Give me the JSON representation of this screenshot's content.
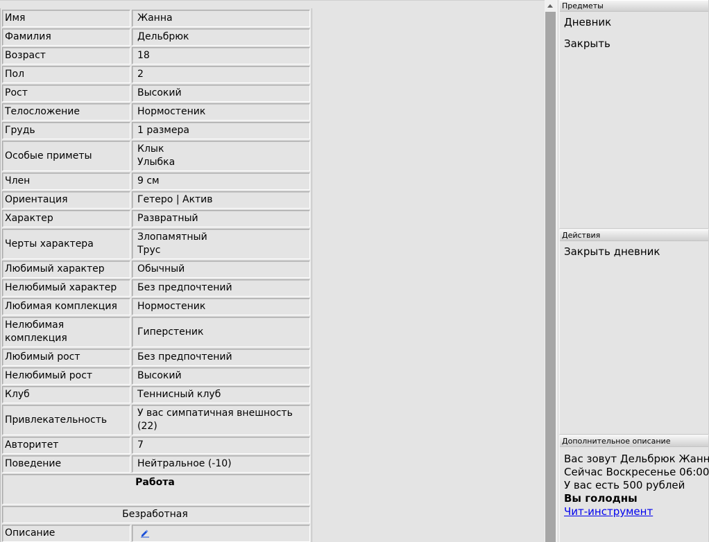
{
  "stats": [
    {
      "label": "Имя",
      "value": [
        "Жанна"
      ]
    },
    {
      "label": "Фамилия",
      "value": [
        "Дельбрюк"
      ]
    },
    {
      "label": "Возраст",
      "value": [
        "18"
      ]
    },
    {
      "label": "Пол",
      "value": [
        "2"
      ]
    },
    {
      "label": "Рост",
      "value": [
        "Высокий"
      ]
    },
    {
      "label": "Телосложение",
      "value": [
        "Нормостеник"
      ]
    },
    {
      "label": "Грудь",
      "value": [
        "1 размера"
      ]
    },
    {
      "label": "Особые приметы",
      "value": [
        "Клык",
        "Улыбка"
      ]
    },
    {
      "label": "Член",
      "value": [
        "9 см"
      ]
    },
    {
      "label": "Ориентация",
      "value": [
        "Гетеро | Актив"
      ]
    },
    {
      "label": "Характер",
      "value": [
        "Развратный"
      ]
    },
    {
      "label": "Черты характера",
      "value": [
        "Злопамятный",
        "Трус"
      ]
    },
    {
      "label": "Любимый характер",
      "value": [
        "Обычный"
      ]
    },
    {
      "label": "Нелюбимый характер",
      "value": [
        "Без предпочтений"
      ]
    },
    {
      "label": "Любимая комплекция",
      "value": [
        "Нормостеник"
      ]
    },
    {
      "label": "Нелюбимая комплекция",
      "value": [
        "Гиперстеник"
      ],
      "label_lines": [
        "Нелюбимая",
        "комплекция"
      ]
    },
    {
      "label": "Любимый рост",
      "value": [
        "Без предпочтений"
      ]
    },
    {
      "label": "Нелюбимый рост",
      "value": [
        "Высокий"
      ]
    },
    {
      "label": "Клуб",
      "value": [
        "Теннисный клуб"
      ]
    },
    {
      "label": "Привлекательность",
      "value": [
        "У вас симпатичная внешность",
        "(22)"
      ]
    },
    {
      "label": "Авторитет",
      "value": [
        "7"
      ]
    },
    {
      "label": "Поведение",
      "value": [
        "Нейтральное (-10)"
      ]
    }
  ],
  "work": {
    "heading": "Работа",
    "job": "Безработная",
    "description_label": "Описание",
    "edit_icon": "pencil-icon"
  },
  "panels": {
    "items": {
      "title": "Предметы",
      "entries": [
        "Дневник",
        "Закрыть"
      ]
    },
    "actions": {
      "title": "Действия",
      "entries": [
        "Закрыть дневник"
      ]
    },
    "description": {
      "title": "Дополнительное описание",
      "lines": [
        "Вас зовут Дельбрюк Жанна.",
        "Сейчас Воскресенье 06:00",
        "У вас есть 500 рублей"
      ],
      "status": "Вы голодны",
      "cheat_link": "Чит-инструмент"
    }
  },
  "colors": {
    "background": "#e4e4e4",
    "link": "#0000ee",
    "scroll_thumb": "#a6a6a6"
  }
}
